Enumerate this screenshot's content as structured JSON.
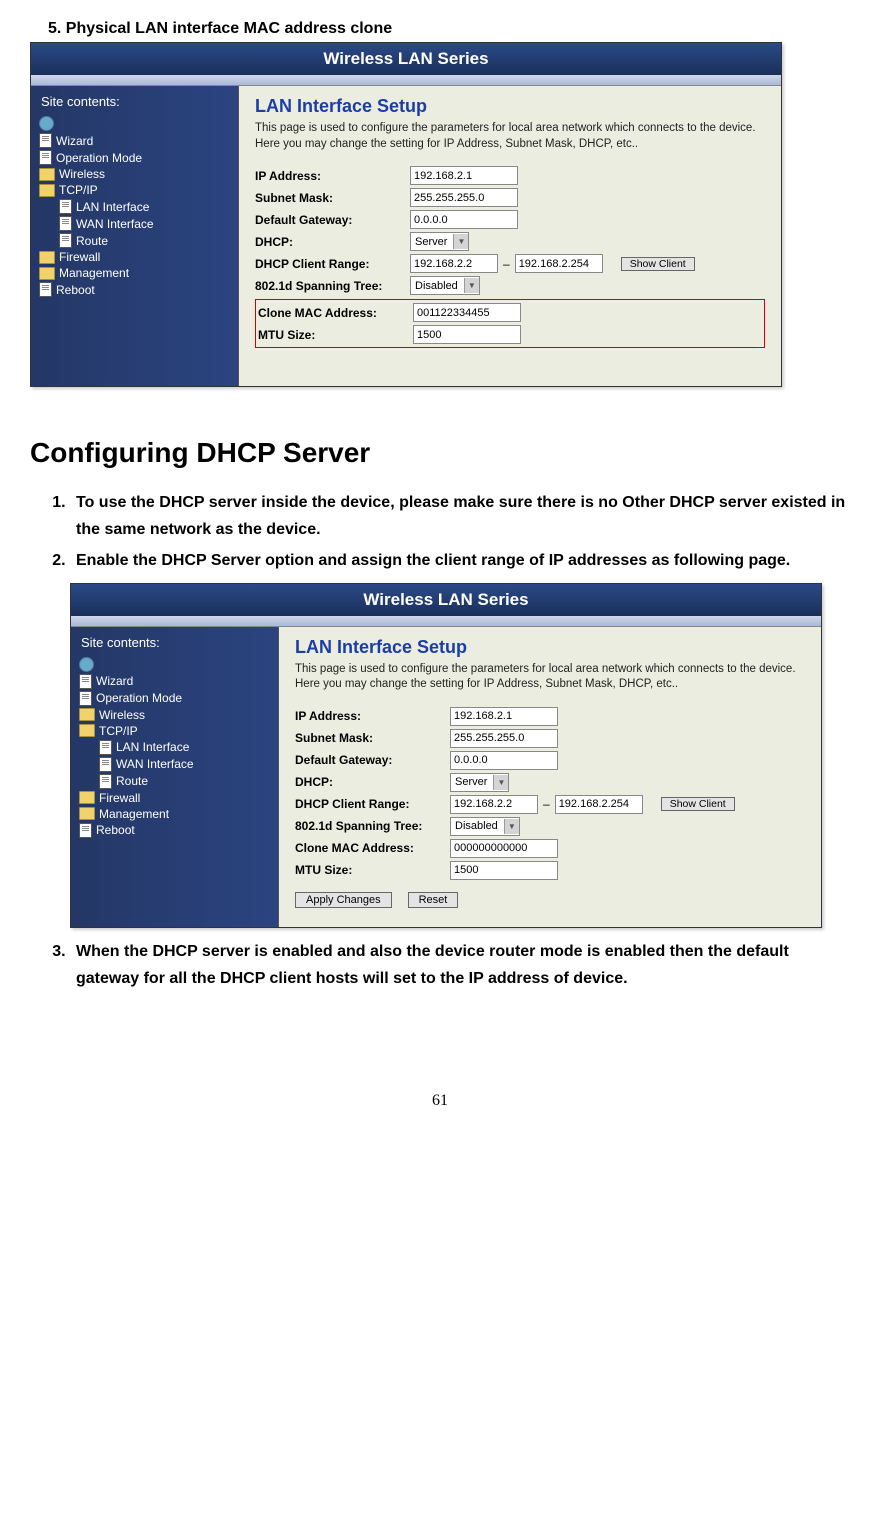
{
  "step5": "5.  Physical LAN interface MAC address clone",
  "shot_header": "Wireless LAN Series",
  "side_title": "Site contents:",
  "tree": {
    "wizard": "Wizard",
    "opmode": "Operation Mode",
    "wireless": "Wireless",
    "tcpip": "TCP/IP",
    "laninterface": "LAN Interface",
    "waninterface": "WAN Interface",
    "route": "Route",
    "firewall": "Firewall",
    "management": "Management",
    "reboot": "Reboot"
  },
  "panel": {
    "title": "LAN Interface Setup",
    "desc": "This page is used to configure the parameters for local area network which connects to the device. Here you may change the setting for IP Address, Subnet Mask, DHCP, etc..",
    "labels": {
      "ip": "IP Address:",
      "subnet": "Subnet Mask:",
      "gateway": "Default Gateway:",
      "dhcp": "DHCP:",
      "range": "DHCP Client Range:",
      "spanning": "802.1d Spanning Tree:",
      "clone": "Clone MAC Address:",
      "mtu": "MTU Size:"
    },
    "vals1": {
      "ip": "192.168.2.1",
      "subnet": "255.255.255.0",
      "gateway": "0.0.0.0",
      "dhcp": "Server",
      "range1": "192.168.2.2",
      "range2": "192.168.2.254",
      "spanning": "Disabled",
      "clone": "001122334455",
      "mtu": "1500"
    },
    "vals2": {
      "ip": "192.168.2.1",
      "subnet": "255.255.255.0",
      "gateway": "0.0.0.0",
      "dhcp": "Server",
      "range1": "192.168.2.2",
      "range2": "192.168.2.254",
      "spanning": "Disabled",
      "clone": "000000000000",
      "mtu": "1500"
    },
    "btn_showclient": "Show Client",
    "btn_apply": "Apply Changes",
    "btn_reset": "Reset"
  },
  "section_title": "Configuring DHCP Server",
  "steps": {
    "s1": "To use the DHCP server inside the device, please make sure there is no Other DHCP server existed in the same network as the device.",
    "s2": "Enable the DHCP Server option and assign the client range of IP addresses as following page.",
    "s3": "When the DHCP server is enabled and also the device router mode is enabled then the default gateway for all the DHCP client hosts will set to the IP address of device."
  },
  "pagenum": "61"
}
